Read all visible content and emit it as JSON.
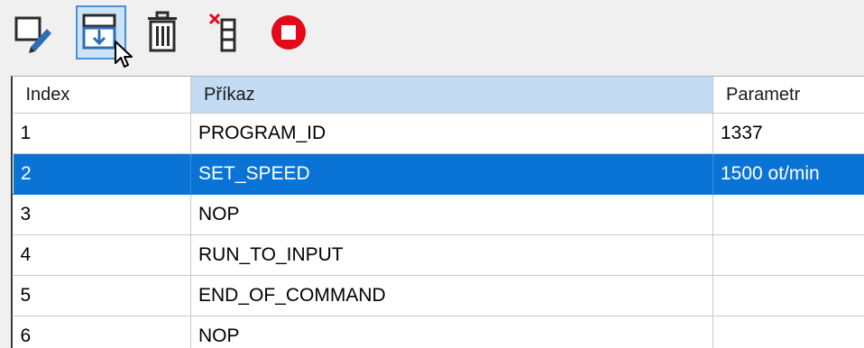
{
  "toolbar": {
    "buttons": [
      {
        "icon": "edit-icon"
      },
      {
        "icon": "insert-below-icon"
      },
      {
        "icon": "trash-icon"
      },
      {
        "icon": "delete-column-icon"
      },
      {
        "icon": "stop-icon"
      }
    ]
  },
  "colors": {
    "selection": "#0a74d6",
    "header_selected": "#c3dcf3",
    "stop_red": "#e3091a",
    "toolbar_hover": "#cce4f7"
  },
  "grid": {
    "columns": [
      "Index",
      "Příkaz",
      "Parametr"
    ],
    "selected_row_index": 1,
    "rows": [
      {
        "index": "1",
        "command": "PROGRAM_ID",
        "param": "1337"
      },
      {
        "index": "2",
        "command": "SET_SPEED",
        "param": "1500 ot/min"
      },
      {
        "index": "3",
        "command": "NOP",
        "param": ""
      },
      {
        "index": "4",
        "command": "RUN_TO_INPUT",
        "param": ""
      },
      {
        "index": "5",
        "command": "END_OF_COMMAND",
        "param": ""
      },
      {
        "index": "6",
        "command": "NOP",
        "param": ""
      }
    ]
  }
}
